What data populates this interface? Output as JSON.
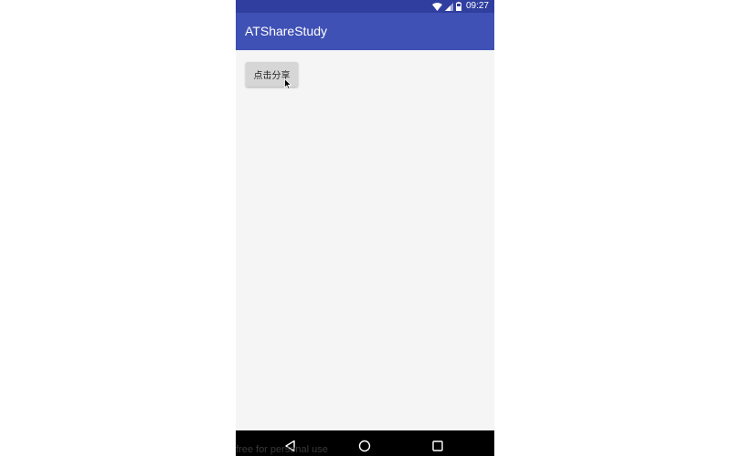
{
  "status_bar": {
    "time": "09:27",
    "icons": [
      "wifi-icon",
      "signal-icon",
      "battery-icon"
    ]
  },
  "app_bar": {
    "title": "ATShareStudy"
  },
  "main": {
    "share_button_label": "点击分享"
  },
  "nav_bar": {
    "icons": [
      "back-icon",
      "home-icon",
      "recents-icon"
    ]
  },
  "watermark": {
    "text": "free for personal use"
  },
  "colors": {
    "status_bar": "#303f9f",
    "app_bar": "#3f51b5",
    "background": "#f5f5f5",
    "button": "#d6d6d6",
    "nav_bar": "#000000"
  }
}
